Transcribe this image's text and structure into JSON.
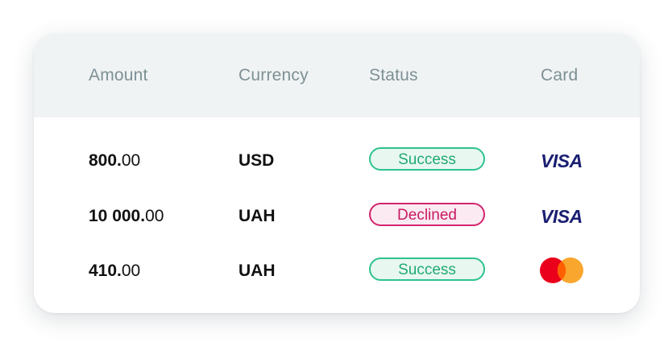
{
  "table": {
    "headers": {
      "amount": "Amount",
      "currency": "Currency",
      "status": "Status",
      "card": "Card"
    },
    "rows": [
      {
        "amount_int": "800.",
        "amount_dec": "00",
        "currency": "USD",
        "status": "Success",
        "status_type": "success",
        "card": "VISA",
        "card_icon": "visa-logo-icon"
      },
      {
        "amount_int": "10 000.",
        "amount_dec": "00",
        "currency": "UAH",
        "status": "Declined",
        "status_type": "declined",
        "card": "VISA",
        "card_icon": "visa-logo-icon"
      },
      {
        "amount_int": "410.",
        "amount_dec": "00",
        "currency": "UAH",
        "status": "Success",
        "status_type": "success",
        "card_icon": "mastercard-logo-icon"
      }
    ]
  },
  "colors": {
    "header_background": "#eff3f4",
    "header_text": "#7e9095",
    "success": "#2ec38e",
    "declined": "#d4246e",
    "visa_blue": "#1a1f71",
    "mastercard_red": "#eb001b",
    "mastercard_orange": "#f79e1b"
  }
}
